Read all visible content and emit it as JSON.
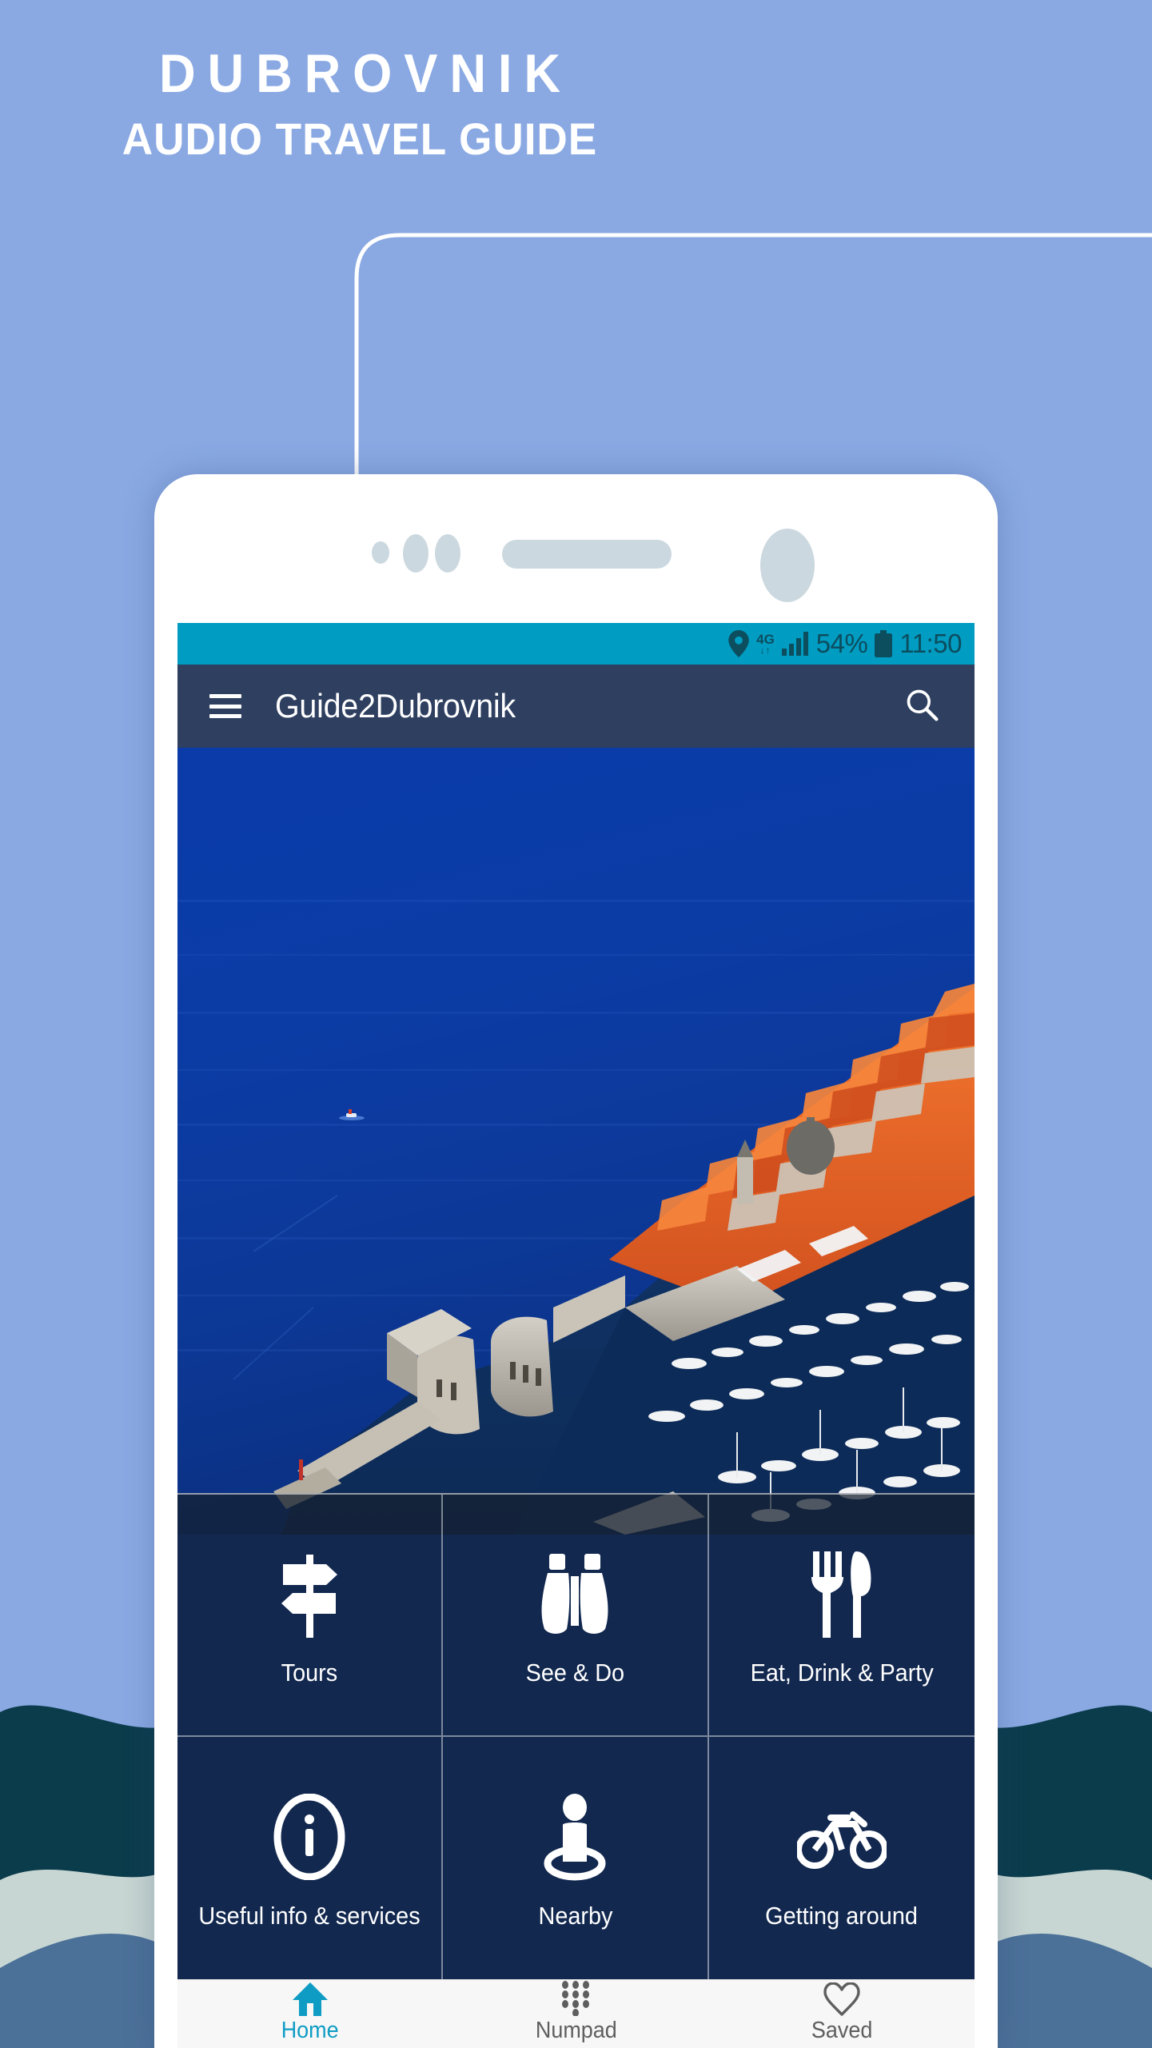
{
  "promo": {
    "title": "DUBROVNIK",
    "subtitle": "AUDIO TRAVEL GUIDE",
    "bg_color": "#8aa9e3"
  },
  "phone": {
    "screen_bg": "#0a3ea8"
  },
  "status_bar": {
    "background": "#009cc2",
    "location_icon": "location-pin-icon",
    "network_label": "4G",
    "network_arrows": "↓↑",
    "signal_icon": "signal-bars-icon",
    "battery_percent": "54%",
    "battery_icon": "battery-icon",
    "clock": "11:50"
  },
  "app_bar": {
    "background": "#2e3f60",
    "menu_icon": "hamburger-menu-icon",
    "title": "Guide2Dubrovnik",
    "search_icon": "search-icon"
  },
  "hero": {
    "alt": "Aerial photo of Dubrovnik old town and harbour on the Adriatic sea"
  },
  "grid": {
    "overlay": "rgba(22,32,48,.74)",
    "tiles": [
      {
        "label": "Tours",
        "icon": "signpost-icon"
      },
      {
        "label": "See & Do",
        "icon": "binoculars-icon"
      },
      {
        "label": "Eat, Drink & Party",
        "icon": "fork-knife-icon"
      },
      {
        "label": "Useful info & services",
        "icon": "info-circle-icon"
      },
      {
        "label": "Nearby",
        "icon": "person-pin-icon"
      },
      {
        "label": "Getting around",
        "icon": "bicycle-icon"
      }
    ]
  },
  "bottom_nav": {
    "background": "#f7f7f7",
    "active_color": "#0e9cc4",
    "inactive_color": "#5e5e5e",
    "items": [
      {
        "label": "Home",
        "icon": "home-icon",
        "active": true
      },
      {
        "label": "Numpad",
        "icon": "numpad-icon",
        "active": false
      },
      {
        "label": "Saved",
        "icon": "heart-icon",
        "active": false
      }
    ]
  },
  "decoration": {
    "wave_colors": [
      "#0b3c4c",
      "#c7d6d2",
      "#4c7199"
    ],
    "callout_color": "#ffffff"
  }
}
